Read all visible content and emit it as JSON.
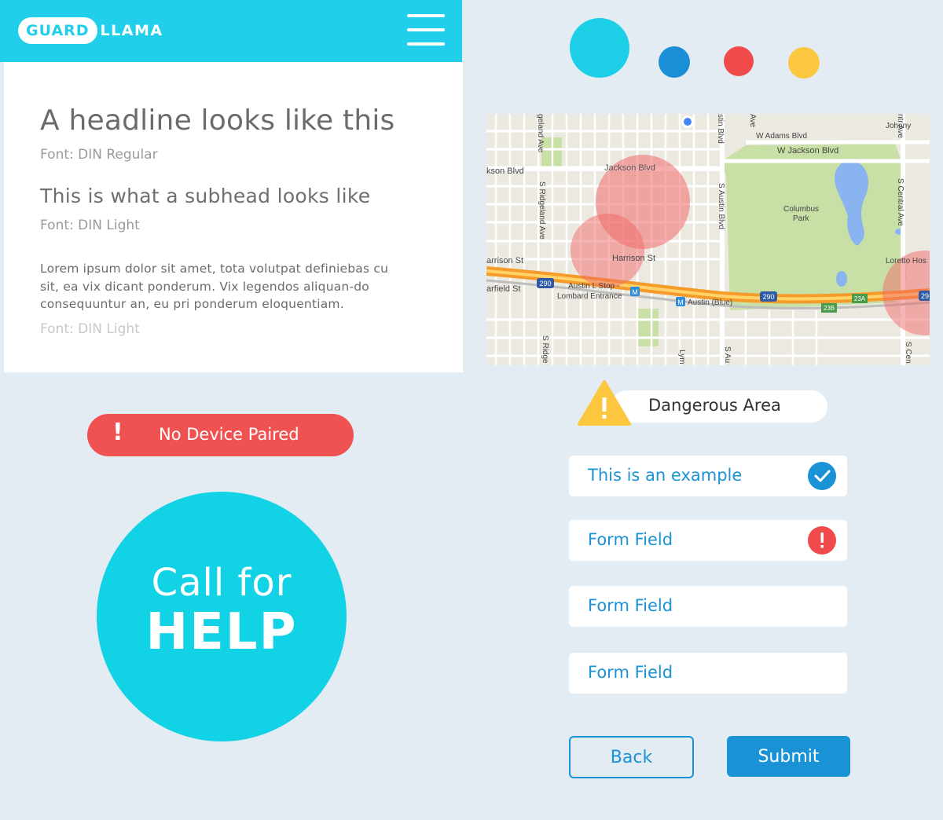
{
  "header": {
    "logo_part1": "GUARD",
    "logo_part2": "LLAMA",
    "menu_icon": "hamburger-menu-icon"
  },
  "typography": {
    "headline": "A headline looks like this",
    "headline_font": "Font: DIN Regular",
    "subhead": "This is what a subhead looks like",
    "subhead_font": "Font: DIN Light",
    "body": "Lorem ipsum dolor sit amet, tota volutpat definiebas cu sit, ea vix dicant ponderum. Vix legendos aliquan-do consequuntur an, eu pri ponderum eloquentiam.",
    "body_font": "Font: DIN Light"
  },
  "alert": {
    "icon": "!",
    "label": "No Device Paired",
    "color": "#f05252"
  },
  "help_button": {
    "line1": "Call for",
    "line2": "HELP",
    "color": "#12d2e6"
  },
  "palette": [
    "#1ecfe8",
    "#1a8fd6",
    "#f04a4a",
    "#fdc63f"
  ],
  "map": {
    "labels": {
      "jackson_blvd_left": "kson Blvd",
      "jackson_blvd": "Jackson Blvd",
      "w_adams": "W Adams Blvd",
      "w_jackson": "W Jackson Blvd",
      "ridgeland": "S Ridgeland Ave",
      "ridgeland_top": "geland Ave",
      "ridge_bottom": "S Ridge",
      "austin_blvd": "S Austin Blvd",
      "austin_top": "stin Blvd",
      "austin_bottom": "S Au",
      "harrison_left": "arrison St",
      "harrison": "Harrison St",
      "garfield": "arfield St",
      "austin_stop": "Austin L Stop -",
      "lombard": "Lombard Entrance",
      "austin_blue": "Austin (Blue)",
      "columbus": "Columbus",
      "park": "Park",
      "central": "S Central Ave",
      "central_bottom": "S Cen",
      "loretto": "Loretto Hos",
      "johnny": "Johnny",
      "lym": "Lym",
      "ave_top": "Ave",
      "ave_top2": "ntr Ave",
      "shield_290_a": "290",
      "shield_290_b": "290",
      "shield_29": "29",
      "exit_23a": "23A",
      "exit_23b": "23B",
      "metro_m": "M"
    }
  },
  "danger_badge": {
    "label": "Dangerous Area",
    "icon": "warning-triangle-icon"
  },
  "form": {
    "fields": [
      {
        "value": "This is an example",
        "status": "valid"
      },
      {
        "value": "Form Field",
        "status": "error"
      },
      {
        "value": "Form Field",
        "status": "none"
      },
      {
        "value": "Form Field",
        "status": "none"
      }
    ],
    "back_label": "Back",
    "submit_label": "Submit"
  }
}
